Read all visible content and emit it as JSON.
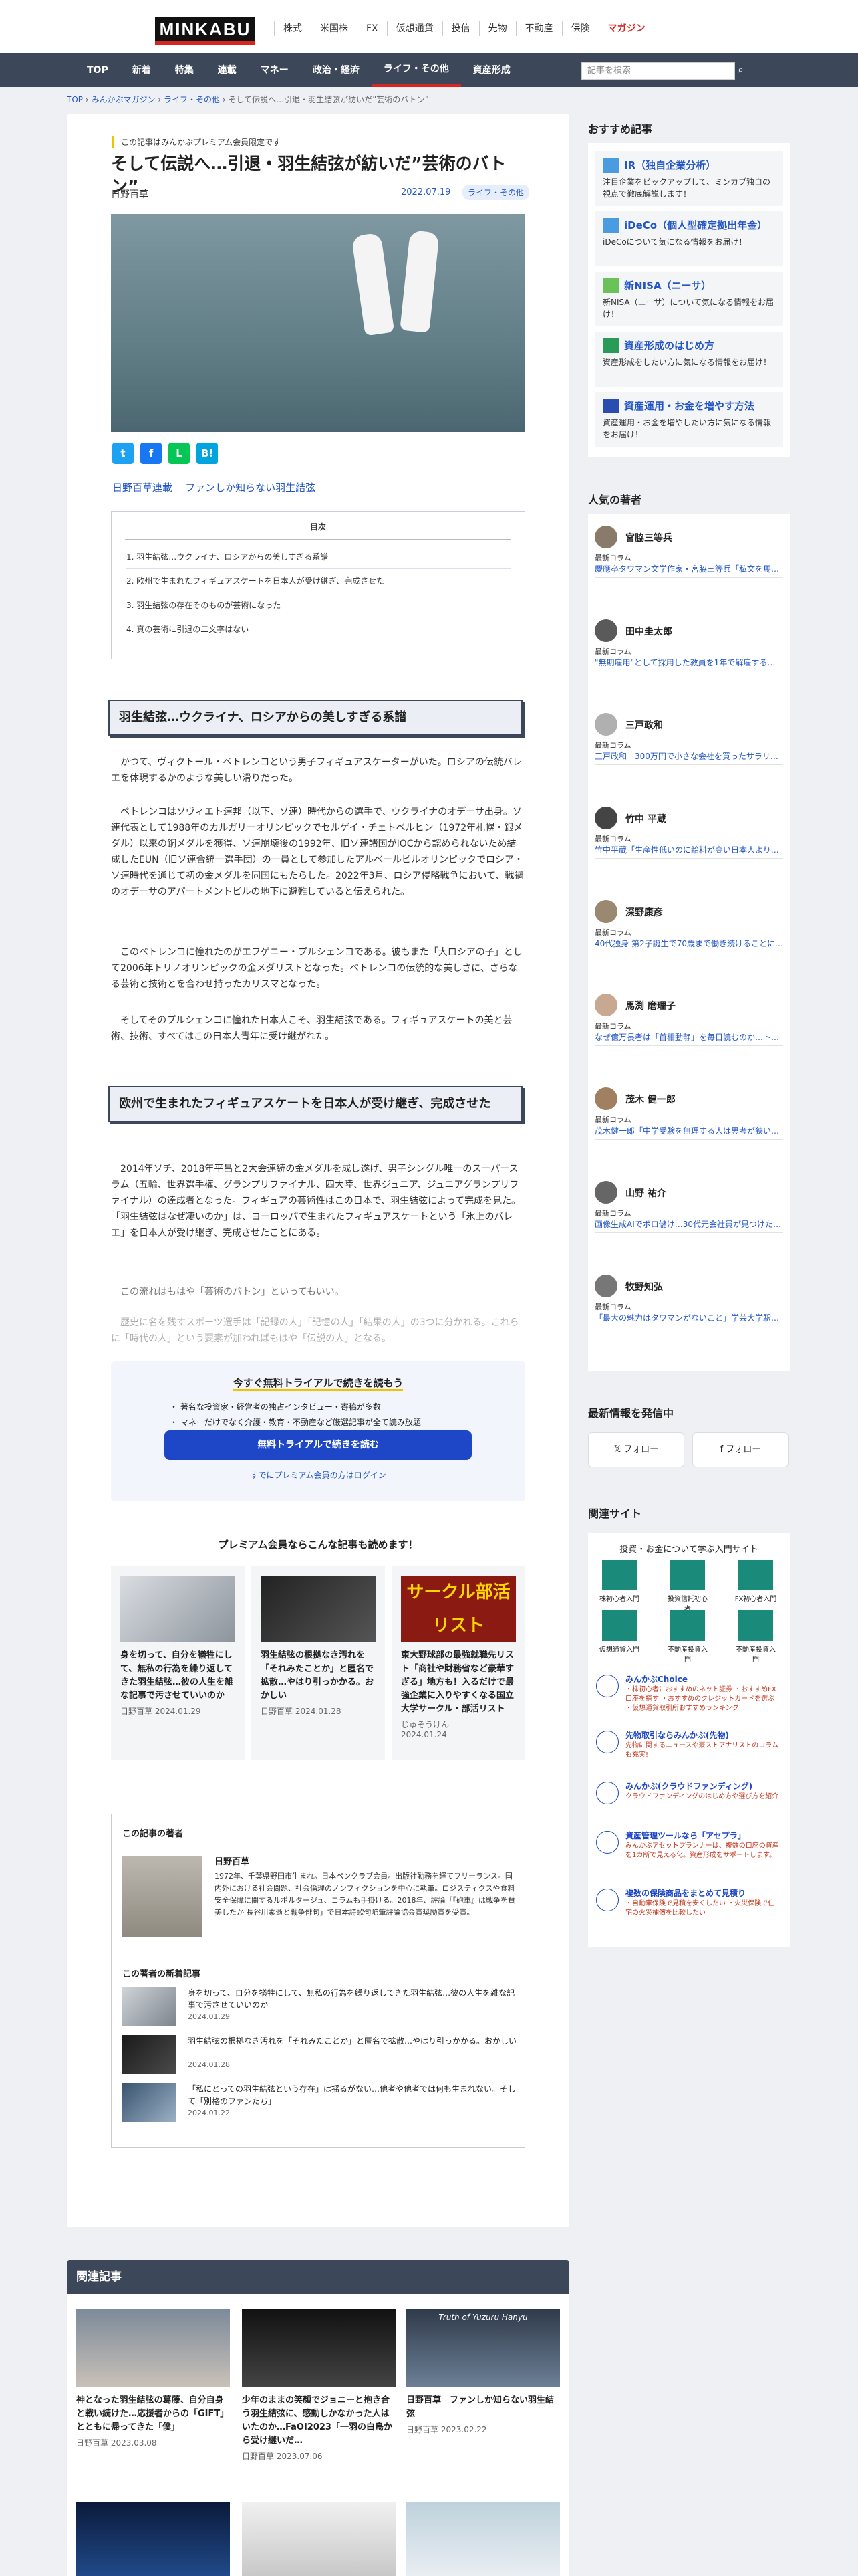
{
  "header": {
    "logo": "MINKABU",
    "top_nav": [
      "株式",
      "米国株",
      "FX",
      "仮想通貨",
      "投信",
      "先物",
      "不動産",
      "保険",
      "マガジン"
    ],
    "main_nav": [
      "TOP",
      "新着",
      "特集",
      "連載",
      "マネー",
      "政治・経済",
      "ライフ・その他",
      "資産形成"
    ],
    "search_placeholder": "記事を検索"
  },
  "breadcrumb": [
    "TOP",
    "みんかぶマガジン",
    "ライフ・その他",
    "そして伝説へ…引退・羽生結弦が紡いだ”芸術のバトン”"
  ],
  "article": {
    "premium_label": "この記事はみんかぶプレミアム会員限定です",
    "title": "そして伝説へ…引退・羽生結弦が紡いだ”芸術のバトン”",
    "author": "日野百草",
    "date": "2022.07.19",
    "category": "ライフ・その他",
    "share": [
      "t",
      "f",
      "L",
      "B!"
    ],
    "tags": [
      "日野百草連載",
      "ファンしか知らない羽生結弦"
    ],
    "toc_title": "目次",
    "toc": [
      "1. 羽生結弦…ウクライナ、ロシアからの美しすぎる系譜",
      "2. 欧州で生まれたフィギュアスケートを日本人が受け継ぎ、完成させた",
      "3. 羽生結弦の存在そのものが芸術になった",
      "4. 真の芸術に引退の二文字はない"
    ],
    "section1": "羽生結弦…ウクライナ、ロシアからの美しすぎる系譜",
    "p1": "かつて、ヴィクトール・ペトレンコという男子フィギュアスケーターがいた。ロシアの伝統バレエを体現するかのような美しい滑りだった。",
    "p2": "ペトレンコはソヴィエト連邦（以下、ソ連）時代からの選手で、ウクライナのオデーサ出身。ソ連代表として1988年のカルガリーオリンピックでセルゲイ・チェトベルヒン（1972年札幌・銀メダル）以来の銅メダルを獲得、ソ連崩壊後の1992年、旧ソ連諸国がIOCから認められないため結成したEUN（旧ソ連合統一選手団）の一員として参加したアルベールビルオリンピックでロシア・ソ連時代を通じて初の金メダルを同国にもたらした。2022年3月、ロシア侵略戦争において、戦禍のオデーサのアパートメントビルの地下に避難していると伝えられた。",
    "p3": "このペトレンコに憧れたのがエフゲニー・プルシェンコである。彼もまた「大ロシアの子」として2006年トリノオリンピックの金メダリストとなった。ペトレンコの伝統的な美しさに、さらなる芸術と技術とを合わせ持ったカリスマとなった。",
    "p4": "そしてそのプルシェンコに憧れた日本人こそ、羽生結弦である。フィギュアスケートの美と芸術、技術、すべてはこの日本人青年に受け継がれた。",
    "section2": "欧州で生まれたフィギュアスケートを日本人が受け継ぎ、完成させた",
    "p5": "2014年ソチ、2018年平昌と2大会連続の金メダルを成し遂げ、男子シングル唯一のスーパースラム（五輪、世界選手権、グランプリファイナル、四大陸、世界ジュニア、ジュニアグランプリファイナル）の達成者となった。フィギュアの芸術性はこの日本で、羽生結弦によって完成を見た。「羽生結弦はなぜ凄いのか」は、ヨーロッパで生まれたフィギュアスケートという「氷上のバレエ」を日本人が受け継ぎ、完成させたことにある。",
    "p6": "この流れはもはや「芸術のバトン」といってもいい。",
    "p7": "歴史に名を残すスポーツ選手は「記録の人」「記憶の人」「結果の人」の3つに分かれる。これらに「時代の人」という要素が加わればもはや「伝説の人」となる。"
  },
  "trial": {
    "title": "今すぐ無料トライアルで続きを読もう",
    "points": [
      "・ 著名な投資家・経営者の独占インタビュー・寄稿が多数",
      "・ マネーだけでなく介護・教育・不動産など厳選記事が全て読み放題"
    ],
    "button": "無料トライアルで続きを読む",
    "login": "すでにプレミアム会員の方はログイン"
  },
  "premium_more": {
    "heading": "プレミアム会員ならこんな記事も読めます！",
    "cards": [
      {
        "title": "身を切って、自分を犠牲にして、無私の行為を繰り返してきた羽生結弦…彼の人生を雑な記事で汚させていいのか",
        "author": "日野百草",
        "date": "2024.01.29"
      },
      {
        "title": "羽生結弦の根拠なき汚れを「それみたことか」と匿名で拡散…やはり引っかかる。おかしい",
        "author": "日野百草",
        "date": "2024.01.28"
      },
      {
        "title": "東大野球部の最強就職先リスト「商社や財務省など豪華すぎる」地方も！入るだけで最強企業に入りやすくなる国立大学サークル・部活リスト",
        "author": "じゅそうけん",
        "date": "2024.01.24",
        "img_text": "サークル部活リスト"
      }
    ]
  },
  "author_box": {
    "heading": "この記事の著者",
    "name": "日野百草",
    "bio": "1972年、千葉県野田市生まれ。日本ペンクラブ会員。出版社勤務を経てフリーランス。国内外における社会問題、社会倫理のノンフィクションを中心に執筆。ロジスティクスや食料安全保障に関するルポルタージュ、コラムも手掛ける。2018年、評論「『砲車』は戦争を賛美したか 長谷川素逝と戦争俳句」で日本詩歌句随筆評論協会賞奨励賞を受賞。",
    "new_heading": "この著者の新着記事",
    "new": [
      {
        "title": "身を切って、自分を犠牲にして、無私の行為を繰り返してきた羽生結弦…彼の人生を雑な記事で汚させていいのか",
        "date": "2024.01.29"
      },
      {
        "title": "羽生結弦の根拠なき汚れを「それみたことか」と匿名で拡散…やはり引っかかる。おかしい",
        "date": "2024.01.28"
      },
      {
        "title": "「私にとっての羽生結弦という存在」は揺るがない…他者や他者では何も生まれない。そして「別格のファンたち」",
        "date": "2024.01.22"
      }
    ]
  },
  "related": {
    "heading": "関連記事",
    "cards": [
      {
        "title": "神となった羽生結弦の葛藤、自分自身と戦い続けた…応援者からの「GIFT」とともに帰ってきた「僕」",
        "author": "日野百草",
        "date": "2023.03.08"
      },
      {
        "title": "少年のままの笑顔でジョニーと抱き合う羽生結弦に、感動しかなかった人はいたのか…FaOI2023「一羽の白鳥から受け継いだ…",
        "author": "日野百草",
        "date": "2023.07.06"
      },
      {
        "title": "日野百草　ファンしか知らない羽生結弦",
        "author": "日野百草",
        "date": "2023.02.22",
        "img_text": "Truth of Yuzuru Hanyu"
      }
    ]
  },
  "sidebar": {
    "recommend_heading": "おすすめ記事",
    "recommend": [
      {
        "title": "IR（独自企業分析）",
        "desc": "注目企業をピックアップして、ミンカブ独自の視点で徹底解説します！",
        "color": "#4a9be0"
      },
      {
        "title": "iDeCo（個人型確定拠出年金）",
        "desc": "iDeCoについて気になる情報をお届け！",
        "color": "#4a9be0"
      },
      {
        "title": "新NISA（ニーサ）",
        "desc": "新NISA（ニーサ）について気になる情報をお届け！",
        "color": "#6cc25a"
      },
      {
        "title": "資産形成のはじめ方",
        "desc": "資産形成をしたい方に気になる情報をお届け！",
        "color": "#2a9a58"
      },
      {
        "title": "資産運用・お金を増やす方法",
        "desc": "資産運用・お金を増やしたい方に気になる情報をお届け！",
        "color": "#2a4db0"
      }
    ],
    "authors_heading": "人気の著者",
    "authors": [
      {
        "name": "宮脇三等兵",
        "label": "最新コラム",
        "article": "慶應卒タワマン文学作家・宮脇三等兵「私文を馬鹿にするネット世論は…"
      },
      {
        "name": "田中圭太郎",
        "label": "最新コラム",
        "article": "\"無期雇用\"として採用した教員を1年で解雇する東北大の是非……文科省「労働契…"
      },
      {
        "name": "三戸政和",
        "label": "最新コラム",
        "article": "三戸政和　300万円で小さな会社を買ったサラリーマン"
      },
      {
        "name": "竹中 平蔵",
        "label": "最新コラム",
        "article": "竹中平蔵「生産性低いのに給料が高い日本人よりも、ChatGPTがありがたい」…AI…"
      },
      {
        "name": "深野康彦",
        "label": "最新コラム",
        "article": "40代独身 第2子誕生で70歳まで働き続けることに…年間収支は26万円の赤字！家売…"
      },
      {
        "name": "馬渕 磨理子",
        "label": "最新コラム",
        "article": "なぜ億万長者は「首相動静」を毎日読むのか…トップトレーダーが読んでいる雑誌…"
      },
      {
        "name": "茂木 健一郎",
        "label": "最新コラム",
        "article": "茂木健一郎「中学受験を無理する人は思考が狭い」無意味な学力競争文化が子供を…"
      },
      {
        "name": "山野 祐介",
        "label": "最新コラム",
        "article": "画像生成AIでボロ儲け…30代元会社員が見つけたマネーツリー「何の能も売れる…"
      },
      {
        "name": "牧野知弘",
        "label": "最新コラム",
        "article": "「最大の魅力はタワマンがないこと」学芸大学駅をなぜ不動産専門家が重視して…"
      }
    ],
    "follow_heading": "最新情報を発信中",
    "follow": [
      "フォロー",
      "フォロー"
    ],
    "sites_heading": "関連サイト",
    "sites_sub": "投資・お金について学ぶ入門サイト",
    "grid": [
      "株初心者入門",
      "投資信託初心者",
      "FX初心者入門",
      "仮想通貨入門",
      "不動産投資入門",
      "不動産投資入門"
    ],
    "links": [
      {
        "title": "みんかぶChoice",
        "desc": "・株初心者におすすめのネット証券 ・おすすめFX口座を探す ・おすすめのクレジットカードを選ぶ ・仮想通貨取引所おすすめランキング"
      },
      {
        "title": "先物取引ならみんかぶ(先物)",
        "desc": "先物に関するニュースや豪ストアナリストのコラムも充実!"
      },
      {
        "title": "みんかぶ(クラウドファンディング)",
        "desc": "クラウドファンディングのはじめ方や選び方を紹介"
      },
      {
        "title": "資産管理ツールなら「アセプラ」",
        "desc": "みんかぶアセットプランナーは、複数の口座の資産を1カ所で見える化。資産形成をサポートします。"
      },
      {
        "title": "複数の保険商品をまとめて見積り",
        "desc": "・自動車保険で見積を安くしたい ・火災保険で住宅の火災補償を比較したい"
      }
    ]
  }
}
